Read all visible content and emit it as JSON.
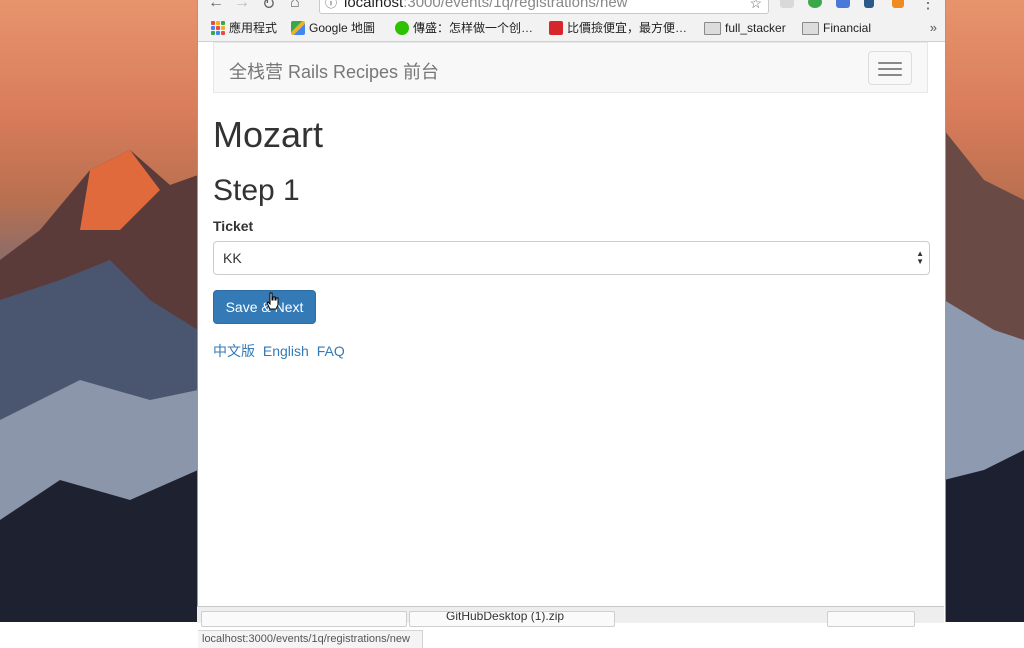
{
  "browser": {
    "url_host": "localhost",
    "url_rest": ":3000/events/1q/registrations/new",
    "bookmarks": [
      "應用程式",
      "Google 地圖",
      "傳盛：怎样做一个创…",
      "比價撿便宜，最方便…",
      "full_stacker",
      "Financial"
    ],
    "more": "»",
    "status_url": "localhost:3000/events/1q/registrations/new",
    "download_item": "GitHubDesktop (1).zip"
  },
  "navbar": {
    "brand": "全栈营 Rails Recipes 前台"
  },
  "main": {
    "title": "Mozart",
    "step": "Step 1",
    "ticket_label": "Ticket",
    "ticket_selected": "KK",
    "submit_label": "Save & Next",
    "lang_links": [
      "中文版",
      "English",
      "FAQ"
    ]
  },
  "colors": {
    "primary": "#337ab7",
    "link": "#337ab7"
  }
}
